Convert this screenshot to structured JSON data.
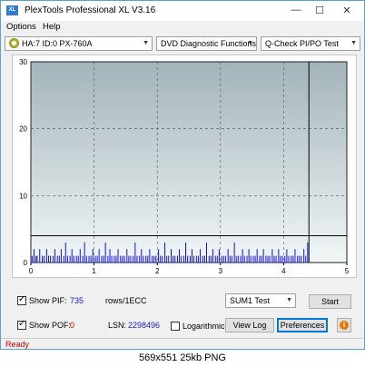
{
  "window": {
    "title": "PlexTools Professional XL V3.16",
    "icon_label": "XL"
  },
  "window_controls": {
    "minimize": "—",
    "maximize": "☐",
    "close": "✕"
  },
  "menu": {
    "options": "Options",
    "help": "Help"
  },
  "toolbar": {
    "drive": "HA:7 ID:0  PX-760A",
    "function": "DVD Diagnostic Functions",
    "test": "Q-Check PI/PO Test"
  },
  "chart_data": {
    "type": "bar",
    "x_min": 0,
    "x_max": 5,
    "y_min": 0,
    "y_max": 30,
    "x_ticks": [
      "0",
      "1",
      "2",
      "3",
      "4",
      "5"
    ],
    "y_ticks": [
      "0",
      "10",
      "20",
      "30"
    ],
    "threshold_y": 4,
    "end_marker_x": 4.4,
    "grid": true,
    "colors": {
      "bars": "#1010e0",
      "bg_top": "#a2b4ba",
      "bg_bottom": "#f2f6f7",
      "threshold": "#000000"
    },
    "x": [
      0.02,
      0.05,
      0.08,
      0.1,
      0.14,
      0.18,
      0.21,
      0.25,
      0.28,
      0.31,
      0.35,
      0.38,
      0.42,
      0.45,
      0.48,
      0.52,
      0.55,
      0.58,
      0.62,
      0.65,
      0.68,
      0.72,
      0.75,
      0.78,
      0.82,
      0.85,
      0.88,
      0.92,
      0.95,
      0.98,
      1.02,
      1.05,
      1.08,
      1.12,
      1.15,
      1.18,
      1.22,
      1.25,
      1.28,
      1.32,
      1.35,
      1.38,
      1.42,
      1.45,
      1.48,
      1.52,
      1.55,
      1.58,
      1.62,
      1.65,
      1.68,
      1.72,
      1.75,
      1.78,
      1.82,
      1.85,
      1.88,
      1.92,
      1.95,
      1.98,
      2.02,
      2.05,
      2.08,
      2.12,
      2.15,
      2.18,
      2.22,
      2.25,
      2.28,
      2.32,
      2.35,
      2.38,
      2.42,
      2.45,
      2.48,
      2.52,
      2.55,
      2.58,
      2.62,
      2.65,
      2.68,
      2.72,
      2.75,
      2.78,
      2.82,
      2.85,
      2.88,
      2.92,
      2.95,
      2.98,
      3.02,
      3.05,
      3.08,
      3.12,
      3.15,
      3.18,
      3.22,
      3.25,
      3.28,
      3.32,
      3.35,
      3.38,
      3.42,
      3.45,
      3.48,
      3.52,
      3.55,
      3.58,
      3.62,
      3.65,
      3.68,
      3.72,
      3.75,
      3.78,
      3.82,
      3.85,
      3.88,
      3.92,
      3.95,
      3.98,
      4.02,
      4.05,
      4.08,
      4.12,
      4.15,
      4.18,
      4.22,
      4.25,
      4.28,
      4.32,
      4.35,
      4.38
    ],
    "values": [
      1,
      2,
      1,
      1,
      2,
      1,
      1,
      2,
      1,
      1,
      1,
      2,
      1,
      1,
      2,
      1,
      3,
      1,
      1,
      2,
      1,
      1,
      1,
      2,
      1,
      3,
      1,
      1,
      1,
      2,
      1,
      1,
      2,
      1,
      1,
      3,
      1,
      2,
      1,
      1,
      1,
      2,
      1,
      1,
      1,
      2,
      1,
      1,
      1,
      3,
      1,
      1,
      2,
      1,
      1,
      1,
      2,
      1,
      1,
      1,
      2,
      1,
      1,
      3,
      1,
      1,
      2,
      1,
      1,
      1,
      2,
      1,
      1,
      3,
      1,
      1,
      2,
      1,
      1,
      1,
      2,
      1,
      1,
      3,
      1,
      1,
      2,
      1,
      1,
      2,
      1,
      1,
      1,
      2,
      1,
      1,
      3,
      1,
      1,
      1,
      2,
      1,
      1,
      2,
      1,
      1,
      1,
      2,
      1,
      1,
      2,
      1,
      1,
      1,
      2,
      1,
      1,
      2,
      1,
      1,
      1,
      2,
      1,
      1,
      1,
      2,
      1,
      1,
      1,
      2,
      1,
      3
    ]
  },
  "controls": {
    "show_pif_label": "Show PIF:",
    "pif_value": "735",
    "rows_label": "rows/1ECC",
    "show_pof_label": "Show POF:",
    "pof_value": "0",
    "lsn_label": "LSN:",
    "lsn_value": "2298496",
    "logarithmic_label": "Logarithmic",
    "sum_select": "SUM1 Test",
    "start": "Start",
    "view_log": "View Log",
    "preferences": "Preferences",
    "info": "i"
  },
  "status": {
    "text": "Ready"
  },
  "footer": {
    "caption": "569x551  25kb  PNG"
  }
}
